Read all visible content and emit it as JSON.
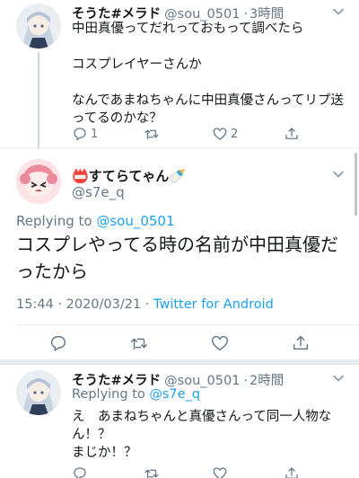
{
  "tweets": {
    "first": {
      "display_name": "そうた#メラド",
      "handle": "@sou_0501",
      "time": "3時間",
      "body": "中田真優ってだれっておもって調べたら\n\nコスプレイヤーさんか\n\nなんであまねちゃんに中田真優さんってリプ送ってるのかな？",
      "reply_count": "1",
      "retweet_count": "",
      "like_count": "2"
    },
    "focused": {
      "display_name": "📛すてらてゃん🍼",
      "handle": "@s7e_q",
      "replying_label": "Replying to ",
      "replying_to": "@sou_0501",
      "body": "コスプレやってる時の名前が中田真優だったから",
      "timestamp": "15:44 · 2020/03/21 · ",
      "client": "Twitter for Android"
    },
    "third": {
      "display_name": "そうた#メラド",
      "handle": "@sou_0501",
      "time": "2時間",
      "replying_label": "Replying to ",
      "replying_to": "@s7e_q",
      "body": "え　あまねちゃんと真優さんって同一人物なん！？\nまじか！？"
    }
  },
  "separator": "·",
  "colors": {
    "link": "#1da1f2",
    "muted": "#657786",
    "text": "#14171a",
    "divider": "#e6ecf0"
  },
  "icons": [
    "reply-icon",
    "retweet-icon",
    "like-icon",
    "share-icon",
    "chevron-down-icon"
  ]
}
